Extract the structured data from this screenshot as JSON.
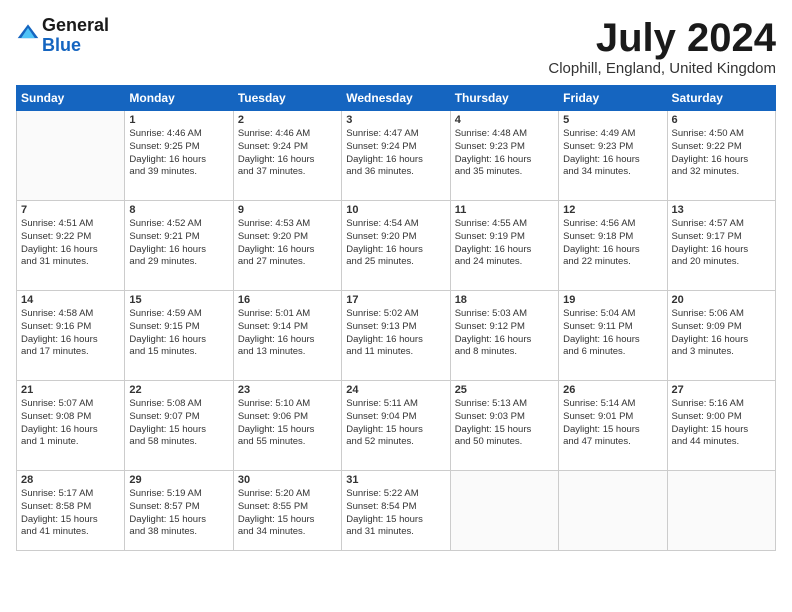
{
  "header": {
    "logo_general": "General",
    "logo_blue": "Blue",
    "month_title": "July 2024",
    "location": "Clophill, England, United Kingdom"
  },
  "days_of_week": [
    "Sunday",
    "Monday",
    "Tuesday",
    "Wednesday",
    "Thursday",
    "Friday",
    "Saturday"
  ],
  "weeks": [
    [
      {
        "day": "",
        "text": ""
      },
      {
        "day": "1",
        "text": "Sunrise: 4:46 AM\nSunset: 9:25 PM\nDaylight: 16 hours\nand 39 minutes."
      },
      {
        "day": "2",
        "text": "Sunrise: 4:46 AM\nSunset: 9:24 PM\nDaylight: 16 hours\nand 37 minutes."
      },
      {
        "day": "3",
        "text": "Sunrise: 4:47 AM\nSunset: 9:24 PM\nDaylight: 16 hours\nand 36 minutes."
      },
      {
        "day": "4",
        "text": "Sunrise: 4:48 AM\nSunset: 9:23 PM\nDaylight: 16 hours\nand 35 minutes."
      },
      {
        "day": "5",
        "text": "Sunrise: 4:49 AM\nSunset: 9:23 PM\nDaylight: 16 hours\nand 34 minutes."
      },
      {
        "day": "6",
        "text": "Sunrise: 4:50 AM\nSunset: 9:22 PM\nDaylight: 16 hours\nand 32 minutes."
      }
    ],
    [
      {
        "day": "7",
        "text": "Sunrise: 4:51 AM\nSunset: 9:22 PM\nDaylight: 16 hours\nand 31 minutes."
      },
      {
        "day": "8",
        "text": "Sunrise: 4:52 AM\nSunset: 9:21 PM\nDaylight: 16 hours\nand 29 minutes."
      },
      {
        "day": "9",
        "text": "Sunrise: 4:53 AM\nSunset: 9:20 PM\nDaylight: 16 hours\nand 27 minutes."
      },
      {
        "day": "10",
        "text": "Sunrise: 4:54 AM\nSunset: 9:20 PM\nDaylight: 16 hours\nand 25 minutes."
      },
      {
        "day": "11",
        "text": "Sunrise: 4:55 AM\nSunset: 9:19 PM\nDaylight: 16 hours\nand 24 minutes."
      },
      {
        "day": "12",
        "text": "Sunrise: 4:56 AM\nSunset: 9:18 PM\nDaylight: 16 hours\nand 22 minutes."
      },
      {
        "day": "13",
        "text": "Sunrise: 4:57 AM\nSunset: 9:17 PM\nDaylight: 16 hours\nand 20 minutes."
      }
    ],
    [
      {
        "day": "14",
        "text": "Sunrise: 4:58 AM\nSunset: 9:16 PM\nDaylight: 16 hours\nand 17 minutes."
      },
      {
        "day": "15",
        "text": "Sunrise: 4:59 AM\nSunset: 9:15 PM\nDaylight: 16 hours\nand 15 minutes."
      },
      {
        "day": "16",
        "text": "Sunrise: 5:01 AM\nSunset: 9:14 PM\nDaylight: 16 hours\nand 13 minutes."
      },
      {
        "day": "17",
        "text": "Sunrise: 5:02 AM\nSunset: 9:13 PM\nDaylight: 16 hours\nand 11 minutes."
      },
      {
        "day": "18",
        "text": "Sunrise: 5:03 AM\nSunset: 9:12 PM\nDaylight: 16 hours\nand 8 minutes."
      },
      {
        "day": "19",
        "text": "Sunrise: 5:04 AM\nSunset: 9:11 PM\nDaylight: 16 hours\nand 6 minutes."
      },
      {
        "day": "20",
        "text": "Sunrise: 5:06 AM\nSunset: 9:09 PM\nDaylight: 16 hours\nand 3 minutes."
      }
    ],
    [
      {
        "day": "21",
        "text": "Sunrise: 5:07 AM\nSunset: 9:08 PM\nDaylight: 16 hours\nand 1 minute."
      },
      {
        "day": "22",
        "text": "Sunrise: 5:08 AM\nSunset: 9:07 PM\nDaylight: 15 hours\nand 58 minutes."
      },
      {
        "day": "23",
        "text": "Sunrise: 5:10 AM\nSunset: 9:06 PM\nDaylight: 15 hours\nand 55 minutes."
      },
      {
        "day": "24",
        "text": "Sunrise: 5:11 AM\nSunset: 9:04 PM\nDaylight: 15 hours\nand 52 minutes."
      },
      {
        "day": "25",
        "text": "Sunrise: 5:13 AM\nSunset: 9:03 PM\nDaylight: 15 hours\nand 50 minutes."
      },
      {
        "day": "26",
        "text": "Sunrise: 5:14 AM\nSunset: 9:01 PM\nDaylight: 15 hours\nand 47 minutes."
      },
      {
        "day": "27",
        "text": "Sunrise: 5:16 AM\nSunset: 9:00 PM\nDaylight: 15 hours\nand 44 minutes."
      }
    ],
    [
      {
        "day": "28",
        "text": "Sunrise: 5:17 AM\nSunset: 8:58 PM\nDaylight: 15 hours\nand 41 minutes."
      },
      {
        "day": "29",
        "text": "Sunrise: 5:19 AM\nSunset: 8:57 PM\nDaylight: 15 hours\nand 38 minutes."
      },
      {
        "day": "30",
        "text": "Sunrise: 5:20 AM\nSunset: 8:55 PM\nDaylight: 15 hours\nand 34 minutes."
      },
      {
        "day": "31",
        "text": "Sunrise: 5:22 AM\nSunset: 8:54 PM\nDaylight: 15 hours\nand 31 minutes."
      },
      {
        "day": "",
        "text": ""
      },
      {
        "day": "",
        "text": ""
      },
      {
        "day": "",
        "text": ""
      }
    ]
  ]
}
